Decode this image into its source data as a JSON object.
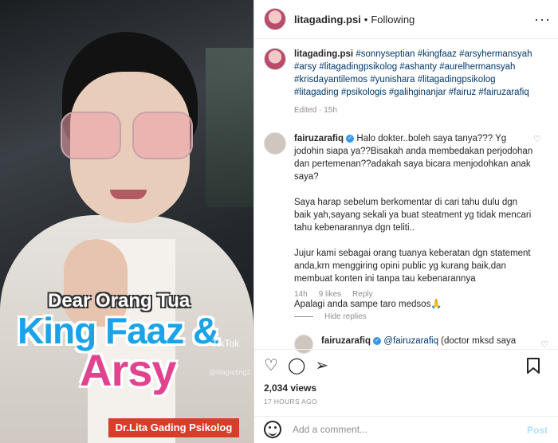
{
  "header": {
    "username": "litagading.psi",
    "separator": "•",
    "follow_status": "Following",
    "more_label": "···"
  },
  "video": {
    "line1": "Dear Orang Tua",
    "line2": "King Faaz &",
    "line3": "Arsy",
    "tiktok_label": "TikTok",
    "tiktok_handle": "@litagading2",
    "banner": "Dr.Lita Gading Psikolog"
  },
  "caption": {
    "username": "litagading.psi",
    "hashtags_line1": "#sonnyseptian #kingfaaz #arsyhermansyah",
    "hashtags_line2": "#arsy #litagadingpsikolog #ashanty #aurelhermansyah",
    "hashtags_line3": "#krisdayantilemos #yunishara #litagadingpsikolog",
    "hashtags_line4": "#litagading #psikologis #galihginanjar #fairuz #fairuzarafiq",
    "edited": "Edited · 15h"
  },
  "comment": {
    "username": "fairuzarafiq",
    "verified": "✓",
    "p1": "Halo dokter..boleh saya tanya??? Yg jodohin siapa ya??Bisakah anda membedakan perjodohan dan pertemenan??adakah saya bicara menjodohkan anak saya?",
    "p2": "Saya harap sebelum berkomentar di cari tahu dulu dgn baik yah,sayang sekali ya buat steatment yg tidak mencari tahu kebenarannya dgn teliti..",
    "p3": "Jujur kami sebagai orang tuanya keberatan dgn statement anda,krn menggiring opini public yg kurang baik,dan membuat konten ini tanpa tau kebenarannya",
    "p4": "Apalagi anda sampe taro medsos🙏",
    "time": "14h",
    "likes": "9 likes",
    "reply_label": "Reply",
    "hide_replies": "Hide replies"
  },
  "reply": {
    "username": "fairuzarafiq",
    "mention": "@fairuzarafiq",
    "text": "(doctor mksd saya"
  },
  "actions": {
    "like_icon": "heart-icon",
    "comment_icon": "comment-icon",
    "share_icon": "share-icon",
    "save_icon": "bookmark-icon"
  },
  "stats": {
    "views": "2,034 views",
    "posted_ago": "17 HOURS AGO"
  },
  "add_comment": {
    "placeholder": "Add a comment...",
    "post_label": "Post"
  },
  "colors": {
    "link_blue": "#00376b",
    "verified_blue": "#3897f0",
    "post_disabled": "#b2dffc",
    "banner_red": "#d93d2a",
    "title_blue": "#1aa3e8",
    "title_pink": "#e1438f"
  }
}
